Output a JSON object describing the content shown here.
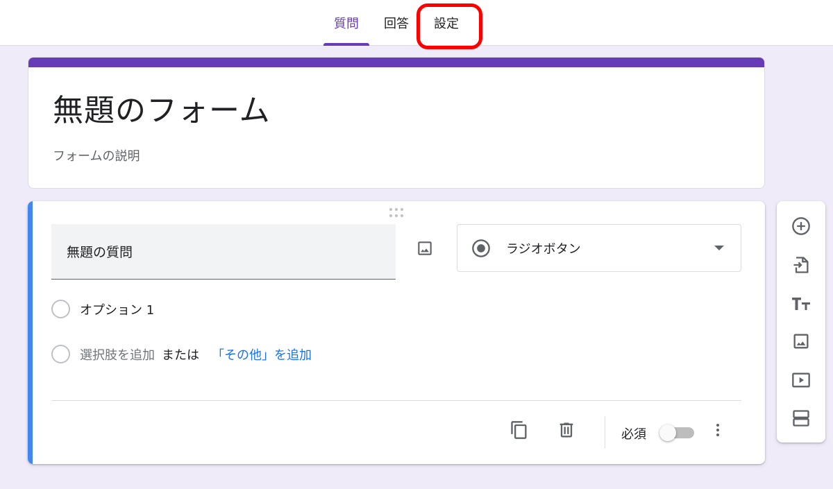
{
  "tabs": {
    "questions": "質問",
    "responses": "回答",
    "settings": "設定"
  },
  "form": {
    "title": "無題のフォーム",
    "description_placeholder": "フォームの説明"
  },
  "question": {
    "title": "無題の質問",
    "type_label": "ラジオボタン",
    "option1": "オプション 1",
    "add_option": "選択肢を追加",
    "or": "または",
    "add_other": "「その他」を追加",
    "required_label": "必須",
    "required": false
  },
  "colors": {
    "accent": "#673ab7",
    "active_card": "#4285f4",
    "link": "#1a73e8",
    "background": "#f0ebf8",
    "highlight": "#ff0000"
  },
  "icons": {
    "side_toolbar": [
      "add-question-icon",
      "import-questions-icon",
      "add-title-icon",
      "add-image-icon",
      "add-video-icon",
      "add-section-icon"
    ],
    "footer": [
      "duplicate-icon",
      "delete-icon",
      "more-vert-icon"
    ]
  }
}
